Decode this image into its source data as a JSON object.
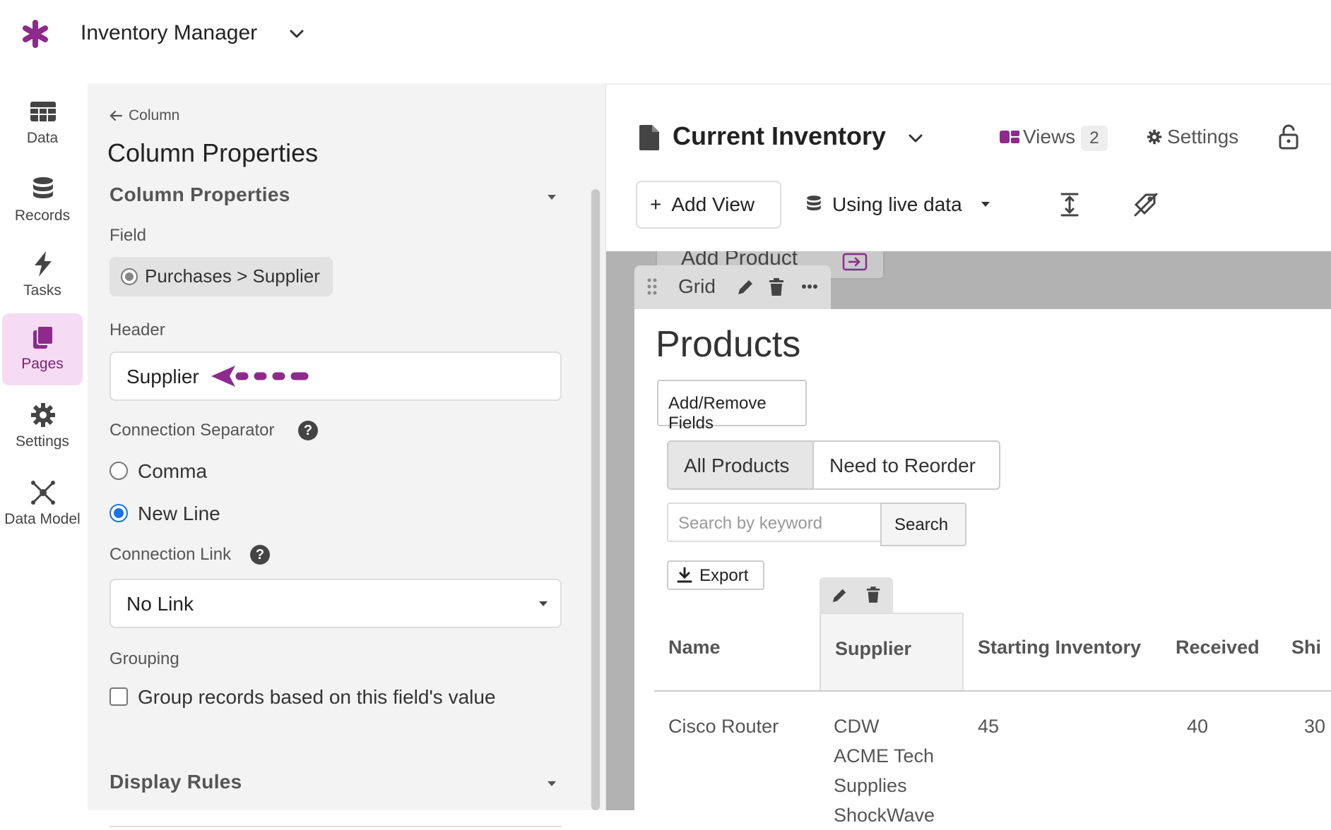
{
  "app": {
    "title": "Inventory Manager"
  },
  "sidebar": {
    "items": [
      {
        "label": "Data",
        "icon": "table-icon"
      },
      {
        "label": "Records",
        "icon": "database-icon"
      },
      {
        "label": "Tasks",
        "icon": "lightning-icon"
      },
      {
        "label": "Pages",
        "icon": "pages-icon",
        "active": true
      },
      {
        "label": "Settings",
        "icon": "gear-icon"
      },
      {
        "label": "Data Model",
        "icon": "network-icon"
      }
    ]
  },
  "panel": {
    "back_label": "Column",
    "title": "Column Properties",
    "section_title": "Column Properties",
    "field_label": "Field",
    "field_value": "Purchases > Supplier",
    "header_label": "Header",
    "header_value": "Supplier",
    "separator_label": "Connection Separator",
    "separator_options": [
      {
        "label": "Comma",
        "checked": false
      },
      {
        "label": "New Line",
        "checked": true
      }
    ],
    "link_label": "Connection Link",
    "link_value": "No Link",
    "grouping_label": "Grouping",
    "grouping_checkbox": "Group records based on this field's value",
    "display_rules": "Display Rules"
  },
  "header": {
    "page_title": "Current Inventory",
    "views_label": "Views",
    "views_count": "2",
    "settings_label": "Settings",
    "add_view_label": "Add View",
    "live_data_label": "Using live data"
  },
  "canvas": {
    "ghost_label": "Add Product",
    "grid_label": "Grid",
    "card_title": "Products",
    "add_remove_label": "Add/Remove Fields",
    "filters": [
      "All Products",
      "Need to Reorder"
    ],
    "search_placeholder": "Search by keyword",
    "search_button": "Search",
    "export_label": "Export",
    "columns": [
      "Name",
      "Supplier",
      "Starting Inventory",
      "Received",
      "Shi"
    ],
    "row": {
      "name": "Cisco Router",
      "supplier_lines": [
        "CDW",
        "ACME Tech",
        "Supplies",
        "ShockWave"
      ],
      "starting": "45",
      "received": "40",
      "shipped": "30"
    }
  },
  "colors": {
    "brand": "#8e2a8c",
    "radio_blue": "#1a73e8",
    "active_nav_bg": "#f5dcf2"
  }
}
